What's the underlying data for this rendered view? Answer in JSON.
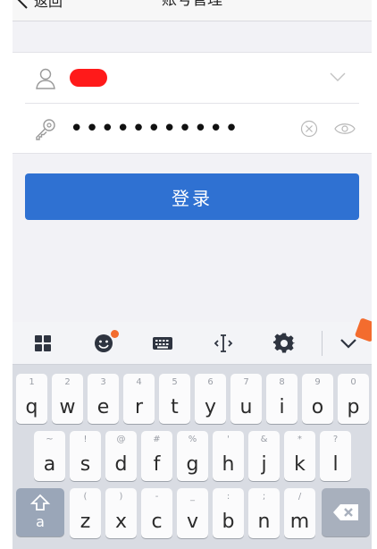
{
  "navbar": {
    "back_label": "返回",
    "title": "账号管理"
  },
  "login_form": {
    "username_value": "",
    "password_value": "•••••••••••"
  },
  "login_button": "登录",
  "keyboard": {
    "row1": [
      {
        "hint": "1",
        "key": "q"
      },
      {
        "hint": "2",
        "key": "w"
      },
      {
        "hint": "3",
        "key": "e"
      },
      {
        "hint": "4",
        "key": "r"
      },
      {
        "hint": "5",
        "key": "t"
      },
      {
        "hint": "6",
        "key": "y"
      },
      {
        "hint": "7",
        "key": "u"
      },
      {
        "hint": "8",
        "key": "i"
      },
      {
        "hint": "9",
        "key": "o"
      },
      {
        "hint": "0",
        "key": "p"
      }
    ],
    "row2": [
      {
        "hint": "~",
        "key": "a"
      },
      {
        "hint": "!",
        "key": "s"
      },
      {
        "hint": "@",
        "key": "d"
      },
      {
        "hint": "#",
        "key": "f"
      },
      {
        "hint": "%",
        "key": "g"
      },
      {
        "hint": "'",
        "key": "h"
      },
      {
        "hint": "&",
        "key": "j"
      },
      {
        "hint": "*",
        "key": "k"
      },
      {
        "hint": "?",
        "key": "l"
      }
    ],
    "row3": [
      {
        "hint": "(",
        "key": "z"
      },
      {
        "hint": ")",
        "key": "x"
      },
      {
        "hint": "-",
        "key": "c"
      },
      {
        "hint": "_",
        "key": "v"
      },
      {
        "hint": ":",
        "key": "b"
      },
      {
        "hint": ";",
        "key": "n"
      },
      {
        "hint": "/",
        "key": "m"
      }
    ],
    "shift_label": "a",
    "toolbar_icons": [
      "apps-grid-icon",
      "emoji-icon",
      "keyboard-icon",
      "cursor-move-icon",
      "gear-icon",
      "chevron-down-icon"
    ]
  },
  "colors": {
    "primary_button": "#2f71d2",
    "redaction": "#ff1a1a",
    "badge": "#f36c2e"
  }
}
